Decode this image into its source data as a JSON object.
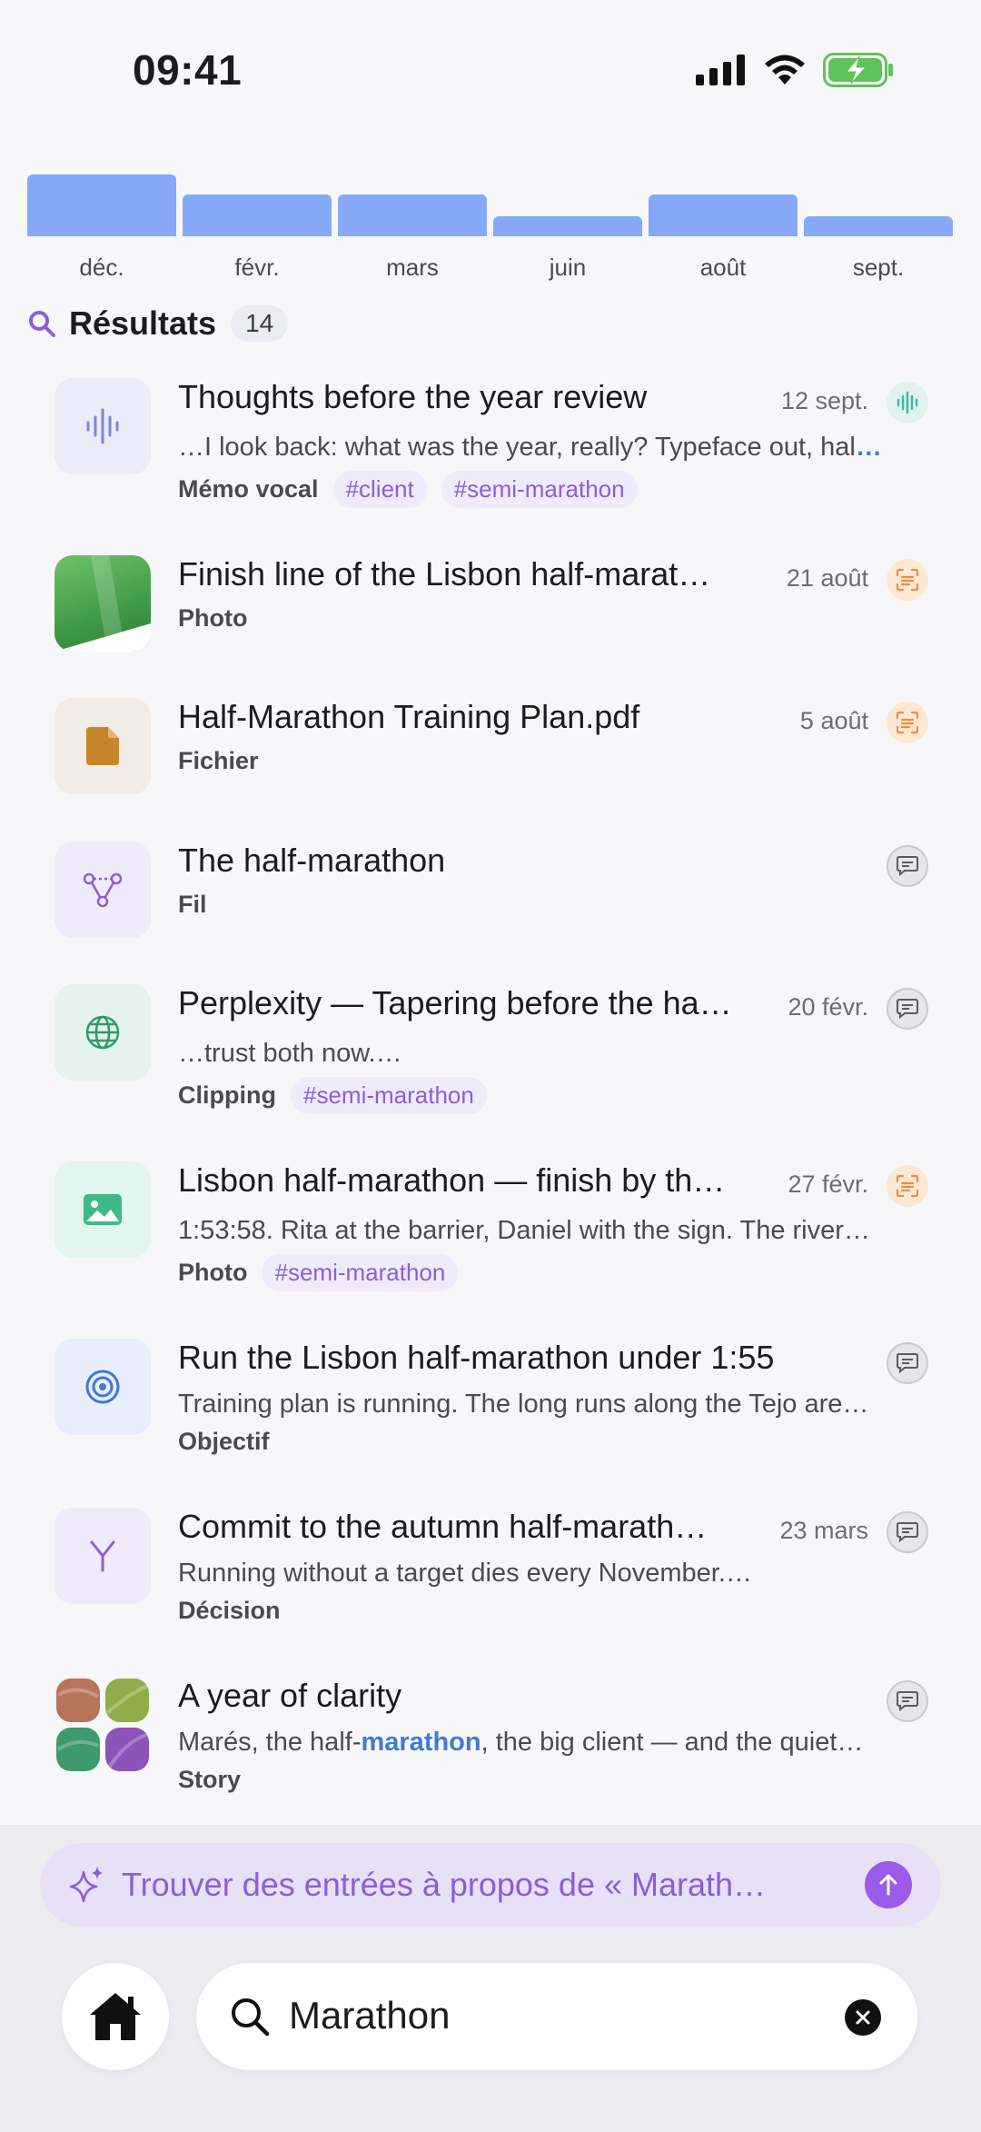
{
  "status": {
    "time": "09:41"
  },
  "histogram": {
    "months": [
      {
        "label": "déc.",
        "level": 1.0
      },
      {
        "label": "févr.",
        "level": 0.67
      },
      {
        "label": "mars",
        "level": 0.67
      },
      {
        "label": "juin",
        "level": 0.33
      },
      {
        "label": "août",
        "level": 0.67
      },
      {
        "label": "sept.",
        "level": 0.33
      }
    ],
    "color": "#86a9f7"
  },
  "results": {
    "title": "Résultats",
    "count": "14"
  },
  "items": [
    {
      "title": "Thoughts before the year review",
      "date": "12 sept.",
      "snippet": "…I look back: what was the year, really? Typeface out, hal",
      "snippet_more": "…",
      "kind": "Mémo vocal",
      "tags": [
        "#client",
        "#semi-marathon"
      ],
      "icon": "voice-wave-icon",
      "badge": "voice-memo-badge-icon"
    },
    {
      "title": "Finish line of the Lisbon half-marat…",
      "date": "21 août",
      "kind": "Photo",
      "icon": "photo-thumbnail",
      "badge": "scan-text-badge-icon"
    },
    {
      "title": "Half-Marathon Training Plan.pdf",
      "date": "5 août",
      "kind": "Fichier",
      "icon": "file-icon",
      "badge": "scan-text-badge-icon"
    },
    {
      "title": "The half-marathon",
      "date": "",
      "kind": "Fil",
      "icon": "thread-nodes-icon",
      "badge": "chat-bubble-badge-icon"
    },
    {
      "title": "Perplexity — Tapering before the ha…",
      "date": "20 févr.",
      "snippet": "…trust both now.…",
      "kind": "Clipping",
      "tags": [
        "#semi-marathon"
      ],
      "icon": "globe-icon",
      "badge": "chat-bubble-badge-icon"
    },
    {
      "title": "Lisbon half-marathon — finish by th…",
      "date": "27 févr.",
      "snippet": "1:53:58. Rita at the barrier, Daniel with the sign. The river…",
      "kind": "Photo",
      "tags": [
        "#semi-marathon"
      ],
      "icon": "image-icon",
      "badge": "scan-text-badge-icon"
    },
    {
      "title": "Run the Lisbon half-marathon under 1:55",
      "date": "",
      "snippet": "Training plan is running. The long runs along the Tejo are…",
      "kind": "Objectif",
      "icon": "target-icon",
      "badge": "chat-bubble-badge-icon"
    },
    {
      "title": "Commit to the autumn half-marath…",
      "date": "23 mars",
      "snippet": "Running without a target dies every November.…",
      "kind": "Décision",
      "icon": "branch-icon",
      "badge": "chat-bubble-badge-icon"
    },
    {
      "title": "A year of clarity",
      "date": "",
      "snippet_pre": "Marés, the half-",
      "snippet_hl": "marathon",
      "snippet_post": ", the big client — and the quiet…",
      "kind": "Story",
      "icon": "story-collage-thumbnail",
      "badge": "chat-bubble-badge-icon"
    }
  ],
  "ai_search": {
    "text": "Trouver des entrées à propos de « Marath…"
  },
  "search": {
    "query": "Marathon"
  },
  "colors": {
    "accent": "#9a5be8",
    "tag_text": "#8a5fd6",
    "tag_bg": "#f0ebfa",
    "highlight": "#3e7bd8"
  }
}
